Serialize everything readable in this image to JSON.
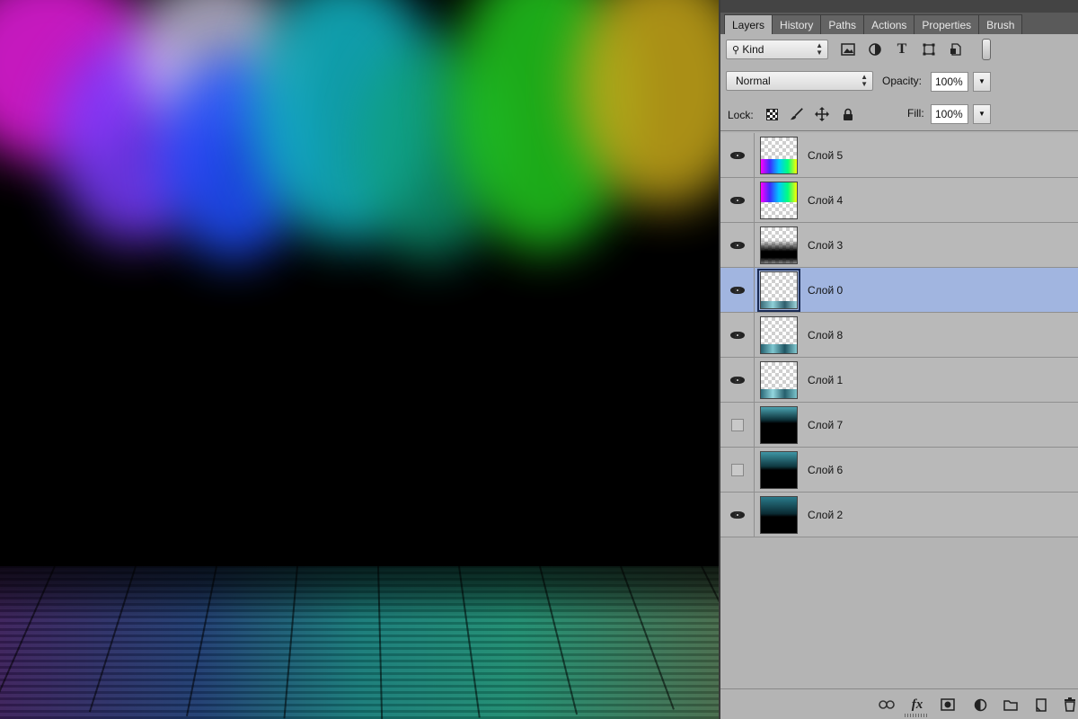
{
  "panel_tabs": [
    {
      "label": "Layers",
      "active": true
    },
    {
      "label": "History",
      "active": false
    },
    {
      "label": "Paths",
      "active": false
    },
    {
      "label": "Actions",
      "active": false
    },
    {
      "label": "Properties",
      "active": false
    },
    {
      "label": "Brush",
      "active": false
    }
  ],
  "filter": {
    "kind_label": "Kind",
    "icons": [
      "pixel-layer-filter-icon",
      "adjustment-layer-filter-icon",
      "type-layer-filter-icon",
      "shape-layer-filter-icon",
      "smart-object-filter-icon",
      "filter-toggle"
    ]
  },
  "blend": {
    "mode": "Normal",
    "opacity_label": "Opacity:",
    "opacity_value": "100%",
    "fill_label": "Fill:",
    "fill_value": "100%"
  },
  "lock": {
    "label": "Lock:",
    "icons": [
      "lock-transparent-pixels-icon",
      "lock-image-pixels-icon",
      "lock-position-icon",
      "lock-all-icon"
    ]
  },
  "layers": [
    {
      "name": "Слой 5",
      "visible": true,
      "selected": false,
      "thumb": "rainbow-bottom"
    },
    {
      "name": "Слой 4",
      "visible": true,
      "selected": false,
      "thumb": "rainbow-top"
    },
    {
      "name": "Слой 3",
      "visible": true,
      "selected": false,
      "thumb": "black-gradient"
    },
    {
      "name": "Слой 0",
      "visible": true,
      "selected": true,
      "thumb": "floor-strip-thin"
    },
    {
      "name": "Слой 8",
      "visible": true,
      "selected": false,
      "thumb": "floor-strip"
    },
    {
      "name": "Слой 1",
      "visible": true,
      "selected": false,
      "thumb": "floor-strip"
    },
    {
      "name": "Слой 7",
      "visible": false,
      "selected": false,
      "thumb": "dark-teal"
    },
    {
      "name": "Слой 6",
      "visible": false,
      "selected": false,
      "thumb": "dark-teal"
    },
    {
      "name": "Слой 2",
      "visible": true,
      "selected": false,
      "thumb": "dark-teal"
    }
  ],
  "bottom_toolbar": [
    "link-layers-icon",
    "fx-icon",
    "add-mask-icon",
    "adjustment-layer-icon",
    "new-group-icon",
    "new-layer-icon",
    "delete-layer-icon"
  ],
  "bottom_fx_label": "fx"
}
